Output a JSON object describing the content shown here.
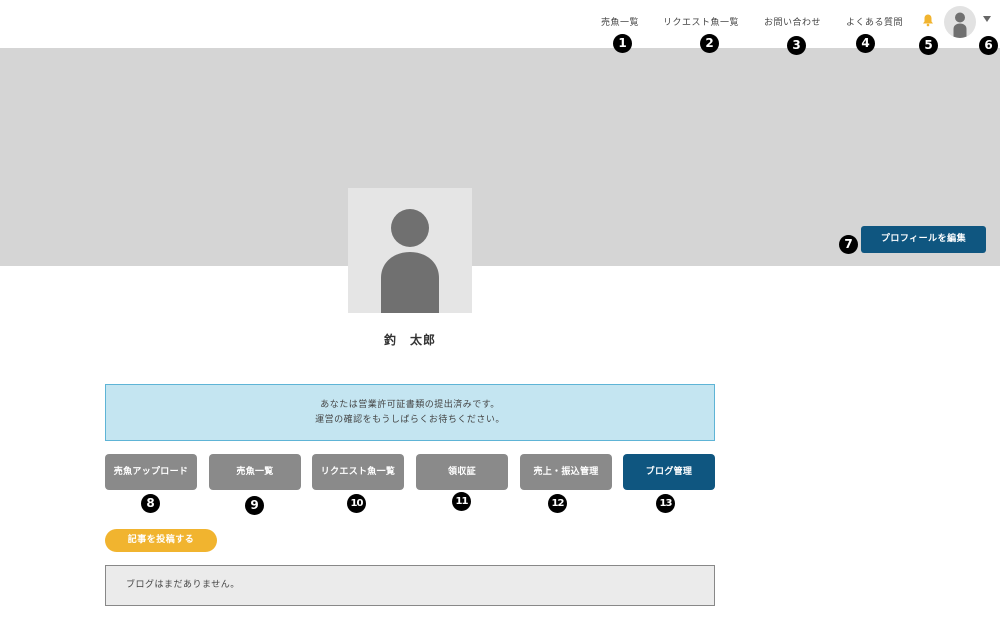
{
  "header": {
    "nav": [
      {
        "label": "売魚一覧"
      },
      {
        "label": "リクエスト魚一覧"
      },
      {
        "label": "お問い合わせ"
      },
      {
        "label": "よくある質問"
      }
    ],
    "bell_color": "#f1b42f"
  },
  "profile": {
    "edit_label": "プロフィールを編集",
    "name": "釣　太郎"
  },
  "notice": {
    "line1": "あなたは営業許可証書類の提出済みです。",
    "line2": "運営の確認をもうしばらくお待ちください。"
  },
  "actions": [
    {
      "label": "売魚アップロード"
    },
    {
      "label": "売魚一覧"
    },
    {
      "label": "リクエスト魚一覧"
    },
    {
      "label": "領収証"
    },
    {
      "label": "売上・振込管理"
    },
    {
      "label": "ブログ管理",
      "active": true
    }
  ],
  "blog": {
    "post_label": "記事を投稿する",
    "empty_text": "ブログはまだありません。"
  },
  "markers": [
    "1",
    "2",
    "3",
    "4",
    "5",
    "6",
    "7",
    "8",
    "9",
    "10",
    "11",
    "12",
    "13"
  ],
  "colors": {
    "primary": "#0f5680",
    "accent": "#f1b42f",
    "button_gray": "#8a8a8a",
    "cover_gray": "#d5d5d5",
    "notice_bg": "#c4e5f1"
  }
}
